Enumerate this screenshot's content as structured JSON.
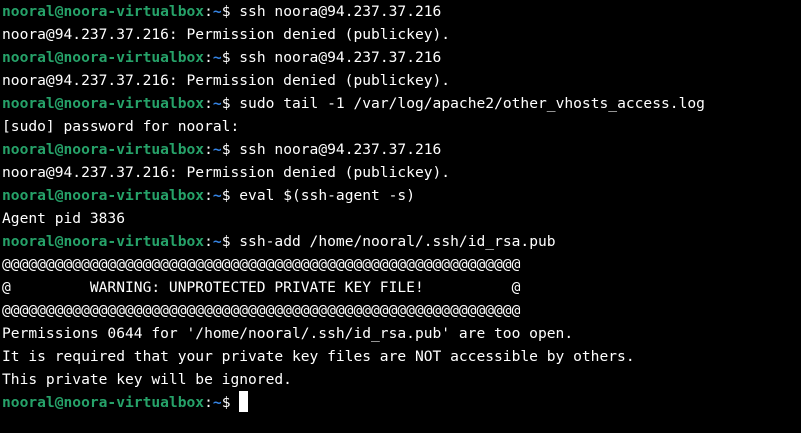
{
  "colors": {
    "background": "#000000",
    "prompt_user": "#26a269",
    "prompt_path": "#3584e4",
    "text": "#ffffff"
  },
  "prompt": {
    "user_host": "nooral@noora-virtualbox",
    "colon": ":",
    "path": "~",
    "dollar": "$ "
  },
  "lines": [
    {
      "type": "cmd",
      "text": "ssh noora@94.237.37.216"
    },
    {
      "type": "out",
      "text": "noora@94.237.37.216: Permission denied (publickey)."
    },
    {
      "type": "cmd",
      "text": "ssh noora@94.237.37.216"
    },
    {
      "type": "out",
      "text": "noora@94.237.37.216: Permission denied (publickey)."
    },
    {
      "type": "cmd",
      "text": "sudo tail -1 /var/log/apache2/other_vhosts_access.log"
    },
    {
      "type": "out",
      "text": "[sudo] password for nooral:"
    },
    {
      "type": "cmd",
      "text": "ssh noora@94.237.37.216"
    },
    {
      "type": "out",
      "text": "noora@94.237.37.216: Permission denied (publickey)."
    },
    {
      "type": "cmd",
      "text": "eval $(ssh-agent -s)"
    },
    {
      "type": "out",
      "text": "Agent pid 3836"
    },
    {
      "type": "cmd",
      "text": "ssh-add /home/nooral/.ssh/id_rsa.pub"
    },
    {
      "type": "out",
      "text": "@@@@@@@@@@@@@@@@@@@@@@@@@@@@@@@@@@@@@@@@@@@@@@@@@@@@@@@@@@@"
    },
    {
      "type": "out",
      "text": "@         WARNING: UNPROTECTED PRIVATE KEY FILE!          @"
    },
    {
      "type": "out",
      "text": "@@@@@@@@@@@@@@@@@@@@@@@@@@@@@@@@@@@@@@@@@@@@@@@@@@@@@@@@@@@"
    },
    {
      "type": "out",
      "text": "Permissions 0644 for '/home/nooral/.ssh/id_rsa.pub' are too open."
    },
    {
      "type": "out",
      "text": "It is required that your private key files are NOT accessible by others."
    },
    {
      "type": "out",
      "text": "This private key will be ignored."
    },
    {
      "type": "cursor",
      "text": ""
    }
  ]
}
